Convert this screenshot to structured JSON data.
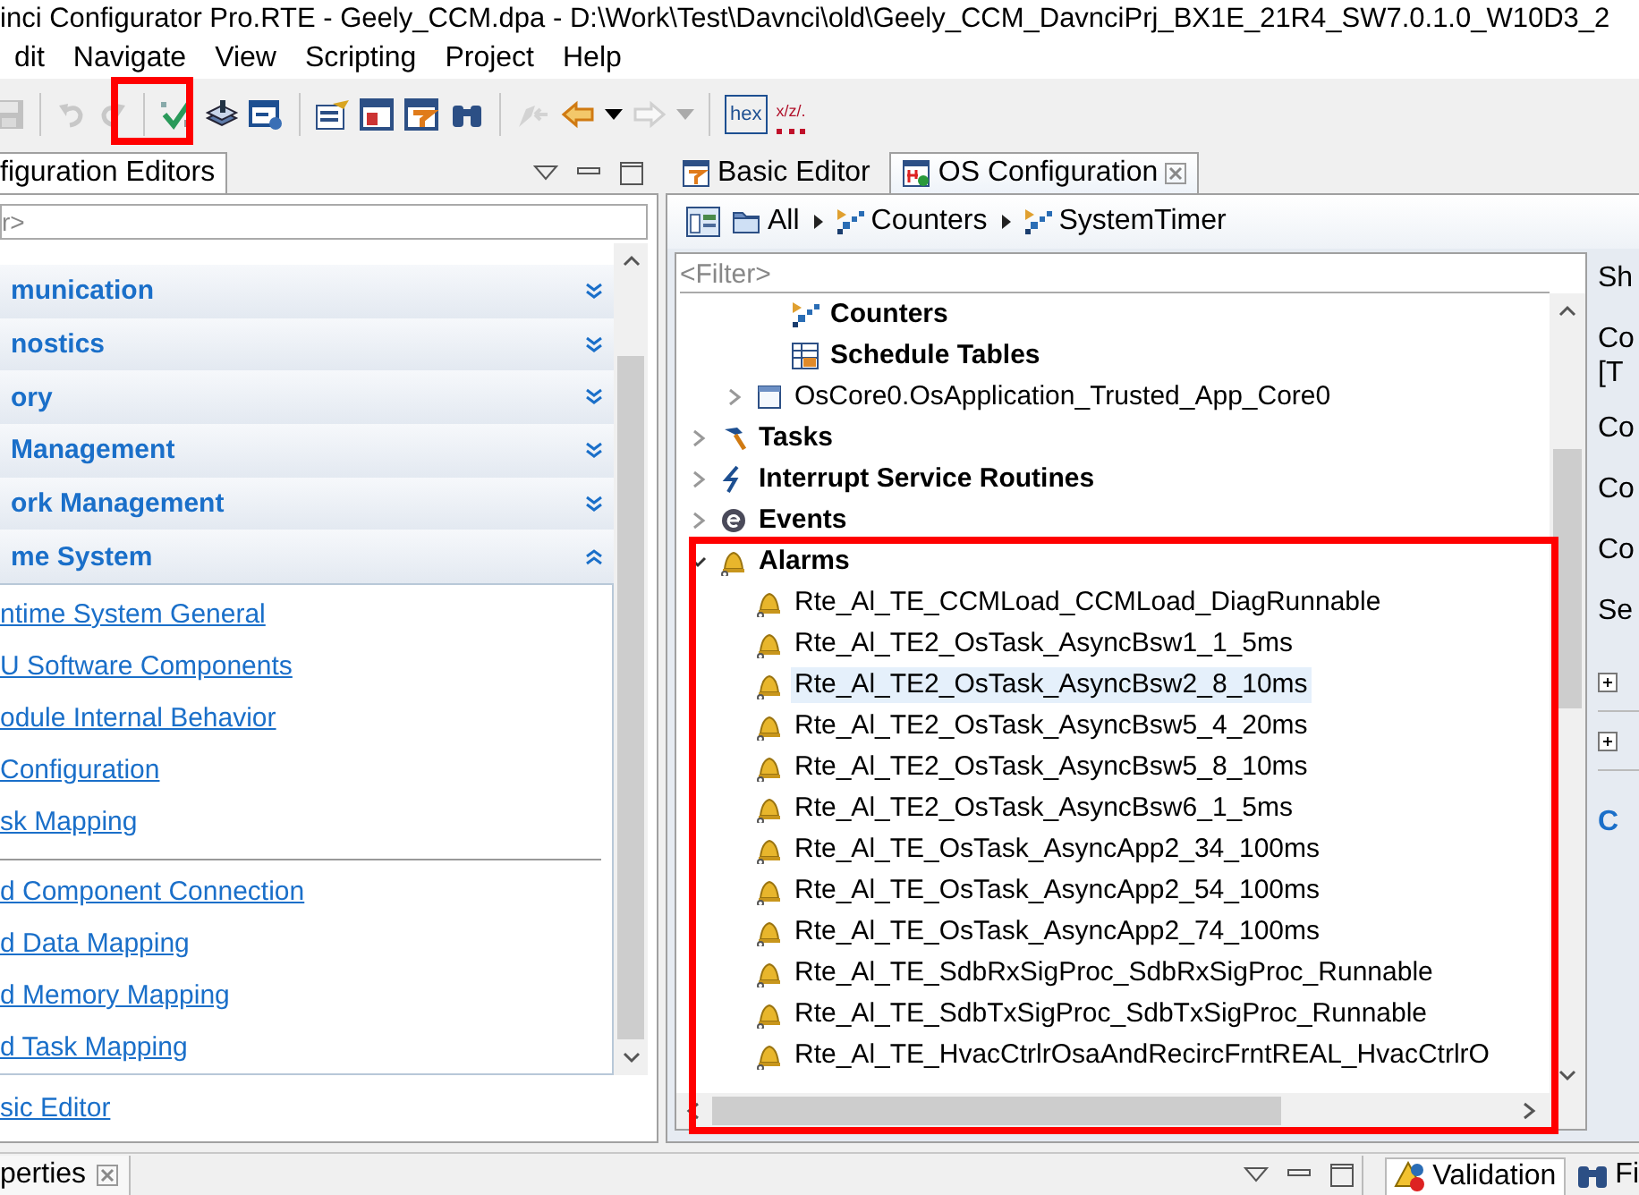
{
  "window": {
    "title": "inci Configurator Pro.RTE - Geely_CCM.dpa - D:\\Work\\Test\\Davnci\\old\\Geely_CCM_DavnciPrj_BX1E_21R4_SW7.0.1.0_W10D3_2"
  },
  "menu": [
    "dit",
    "Navigate",
    "View",
    "Scripting",
    "Project",
    "Help"
  ],
  "toolbar": [
    [
      {
        "kind": "save",
        "disabled": true
      }
    ],
    [
      {
        "kind": "undo",
        "disabled": true
      },
      {
        "kind": "redo",
        "disabled": true
      }
    ],
    [
      {
        "kind": "validate",
        "disabled": false
      },
      {
        "kind": "generate",
        "disabled": false
      },
      {
        "kind": "settings",
        "disabled": false
      }
    ],
    [
      {
        "kind": "properties",
        "disabled": false
      },
      {
        "kind": "window",
        "disabled": false
      },
      {
        "kind": "component",
        "disabled": false
      },
      {
        "kind": "find",
        "disabled": false
      }
    ],
    [
      {
        "kind": "pen",
        "disabled": true
      },
      {
        "kind": "back",
        "disabled": false
      },
      {
        "kind": "caret",
        "disabled": false
      },
      {
        "kind": "forward",
        "disabled": true
      },
      {
        "kind": "caret",
        "disabled": true
      }
    ],
    [
      {
        "kind": "hex",
        "label": "hex",
        "disabled": false
      },
      {
        "kind": "xlz",
        "label": "x/z/.",
        "disabled": false
      }
    ]
  ],
  "left_view": {
    "tab": {
      "label": "figuration Editors"
    },
    "filter": {
      "placeholder": "r>"
    },
    "sections": [
      {
        "label": "munication",
        "expanded": false
      },
      {
        "label": "nostics",
        "expanded": false
      },
      {
        "label": "ory",
        "expanded": false
      },
      {
        "label": "Management",
        "expanded": false
      },
      {
        "label": "ork Management",
        "expanded": false
      },
      {
        "label": "me System",
        "expanded": true,
        "link_groups": [
          [
            "ntime System General",
            "U Software Components",
            "odule Internal Behavior",
            "Configuration",
            "sk Mapping"
          ],
          [
            "d Component Connection",
            "d Data Mapping",
            "d Memory Mapping",
            "d Task Mapping"
          ]
        ]
      }
    ],
    "footer_link": "sic Editor"
  },
  "editor": {
    "tabs": [
      {
        "label": "Basic Editor",
        "selected": false
      },
      {
        "label": "OS Configuration",
        "selected": true
      }
    ],
    "breadcrumb": [
      {
        "label": "All",
        "kind": "folder"
      },
      {
        "label": "Counters",
        "kind": "counter"
      },
      {
        "label": "SystemTimer",
        "kind": "counter"
      }
    ],
    "filter": {
      "placeholder": "<Filter>"
    },
    "tree": [
      {
        "children": [
          {
            "children": [
              {
                "label": "Counters",
                "kind": "counters",
                "selected": false
              },
              {
                "label": "Schedule Tables",
                "kind": "schedule_tables",
                "selected": false
              }
            ]
          },
          {
            "label": "OsCore0.OsApplication_Trusted_App_Core0",
            "kind": "application",
            "selected": false,
            "expanded": false
          }
        ]
      },
      {
        "label": "Tasks",
        "kind": "tasks",
        "selected": false,
        "expanded": false
      },
      {
        "label": "Interrupt Service Routines",
        "kind": "isrs",
        "selected": false,
        "expanded": false
      },
      {
        "label": "Events",
        "kind": "events",
        "selected": false,
        "expanded": false
      },
      {
        "label": "Alarms",
        "kind": "alarms",
        "selected": false,
        "expanded": true,
        "children": [
          {
            "label": "Rte_Al_TE_CCMLoad_CCMLoad_DiagRunnable",
            "kind": "alarm",
            "selected": false
          },
          {
            "label": "Rte_Al_TE2_OsTask_AsyncBsw1_1_5ms",
            "kind": "alarm",
            "selected": false
          },
          {
            "label": "Rte_Al_TE2_OsTask_AsyncBsw2_8_10ms",
            "kind": "alarm",
            "selected": true
          },
          {
            "label": "Rte_Al_TE2_OsTask_AsyncBsw5_4_20ms",
            "kind": "alarm",
            "selected": false
          },
          {
            "label": "Rte_Al_TE2_OsTask_AsyncBsw5_8_10ms",
            "kind": "alarm",
            "selected": false
          },
          {
            "label": "Rte_Al_TE2_OsTask_AsyncBsw6_1_5ms",
            "kind": "alarm",
            "selected": false
          },
          {
            "label": "Rte_Al_TE_OsTask_AsyncApp2_34_100ms",
            "kind": "alarm",
            "selected": false
          },
          {
            "label": "Rte_Al_TE_OsTask_AsyncApp2_54_100ms",
            "kind": "alarm",
            "selected": false
          },
          {
            "label": "Rte_Al_TE_OsTask_AsyncApp2_74_100ms",
            "kind": "alarm",
            "selected": false
          },
          {
            "label": "Rte_Al_TE_SdbRxSigProc_SdbRxSigProc_Runnable",
            "kind": "alarm",
            "selected": false
          },
          {
            "label": "Rte_Al_TE_SdbTxSigProc_SdbTxSigProc_Runnable",
            "kind": "alarm",
            "selected": false
          },
          {
            "label": "Rte_Al_TE_HvacCtrlrOsaAndRecircFrntREAL_HvacCtrlrO",
            "kind": "alarm",
            "selected": false
          }
        ]
      }
    ],
    "side_panel": [
      {
        "kind": "label",
        "text": "Sh"
      },
      {
        "kind": "label",
        "text": "Co"
      },
      {
        "kind": "continuation",
        "text": "[T"
      },
      {
        "kind": "label",
        "text": "Co"
      },
      {
        "kind": "label",
        "text": "Co"
      },
      {
        "kind": "label",
        "text": "Co"
      },
      {
        "kind": "label",
        "text": "Se"
      },
      {
        "kind": "expander"
      },
      {
        "kind": "expander"
      },
      {
        "kind": "section",
        "text": "C"
      }
    ]
  },
  "bottom": {
    "left_tabs": [
      {
        "label": "perties"
      }
    ],
    "right_tabs": [
      {
        "label": "Validation",
        "kind": "validation"
      },
      {
        "label": "Fi",
        "kind": "find"
      }
    ]
  }
}
